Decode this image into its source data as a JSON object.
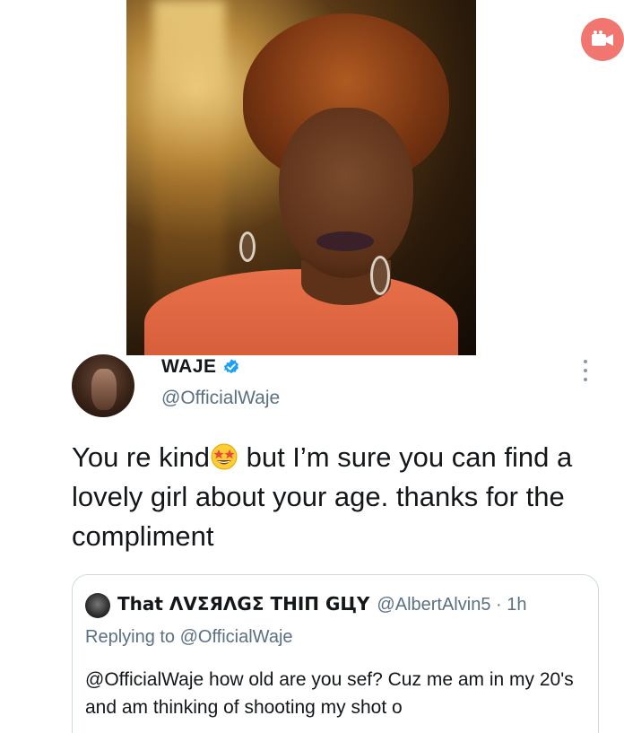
{
  "tweet": {
    "display_name": "WAJE",
    "handle": "@OfficialWaje",
    "verified_icon": "verified-badge-icon",
    "text_part1": "You re kind",
    "emoji": "star-struck-emoji",
    "text_part2": " but I’m sure you can find a lovely girl about your age. thanks for the compliment"
  },
  "quoted_tweet": {
    "display_name": "That ΛVΣЯΛGΣ THIП GЦY",
    "handle_time": "@AlbertAlvin5 · 1h",
    "replying_to": "Replying to @OfficialWaje",
    "text": "@OfficialWaje how old are you sef? Cuz me am in my 20's and am thinking of shooting my shot o"
  },
  "colors": {
    "verified_blue": "#1da1f2",
    "secondary_text": "#5b7083",
    "video_badge": "#f0766f"
  }
}
